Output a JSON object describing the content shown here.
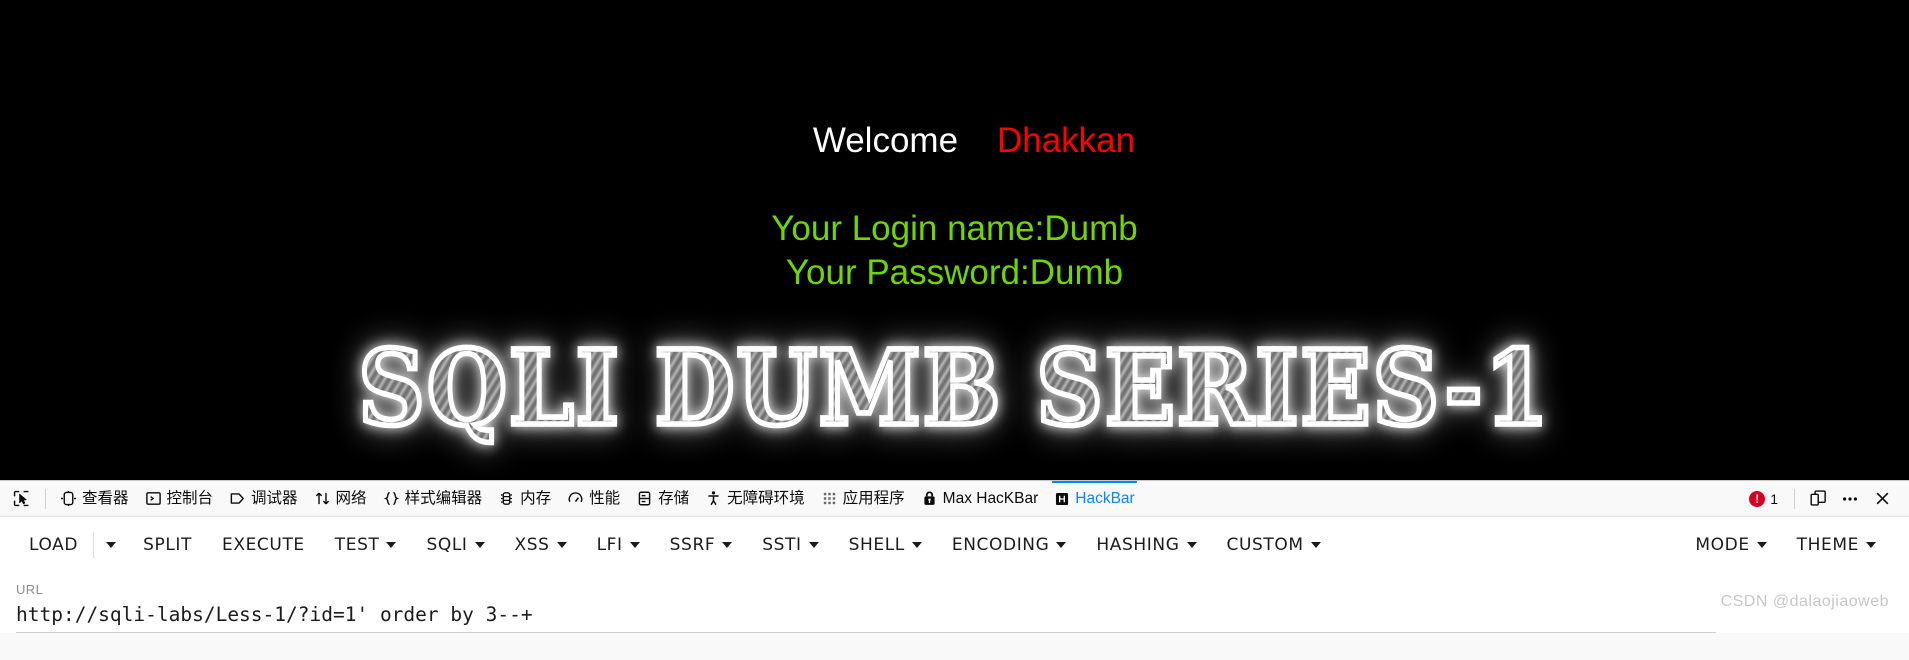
{
  "page": {
    "welcome_prefix": "Welcome",
    "welcome_user": "Dhakkan",
    "login_line": "Your Login name:Dumb",
    "password_line": "Your Password:Dumb",
    "banner_text": "SQLI DUMB SERIES-1",
    "colors": {
      "background": "#000000",
      "welcome_prefix": "#ffffff",
      "welcome_user": "#ff0000",
      "credentials": "#6fd600"
    }
  },
  "devtools": {
    "tabs": [
      {
        "label": "查看器",
        "icon": "inspector-icon",
        "active": false
      },
      {
        "label": "控制台",
        "icon": "console-icon",
        "active": false
      },
      {
        "label": "调试器",
        "icon": "debugger-icon",
        "active": false
      },
      {
        "label": "网络",
        "icon": "network-icon",
        "active": false
      },
      {
        "label": "样式编辑器",
        "icon": "style-editor-icon",
        "active": false
      },
      {
        "label": "内存",
        "icon": "memory-icon",
        "active": false
      },
      {
        "label": "性能",
        "icon": "performance-icon",
        "active": false
      },
      {
        "label": "存储",
        "icon": "storage-icon",
        "active": false
      },
      {
        "label": "无障碍环境",
        "icon": "accessibility-icon",
        "active": false
      },
      {
        "label": "应用程序",
        "icon": "application-icon",
        "active": false
      },
      {
        "label": "Max HacKBar",
        "icon": "lock-icon",
        "active": false
      },
      {
        "label": "HackBar",
        "icon": "hackbar-icon",
        "active": true
      }
    ],
    "picker_icon": "element-picker-icon",
    "right": {
      "error_count": "1",
      "error_icon": "error-badge-icon",
      "responsive_icon": "responsive-design-mode-icon",
      "meatball_icon": "more-options-icon",
      "close_icon": "close-icon"
    },
    "active_tab_color": "#0a84ff",
    "error_color": "#d70022"
  },
  "hackbar": {
    "menu": [
      {
        "label": "LOAD",
        "caret": false,
        "split_caret": true
      },
      {
        "label": "SPLIT",
        "caret": false,
        "split_caret": false
      },
      {
        "label": "EXECUTE",
        "caret": false,
        "split_caret": false
      },
      {
        "label": "TEST",
        "caret": true,
        "split_caret": false
      },
      {
        "label": "SQLI",
        "caret": true,
        "split_caret": false
      },
      {
        "label": "XSS",
        "caret": true,
        "split_caret": false
      },
      {
        "label": "LFI",
        "caret": true,
        "split_caret": false
      },
      {
        "label": "SSRF",
        "caret": true,
        "split_caret": false
      },
      {
        "label": "SSTI",
        "caret": true,
        "split_caret": false
      },
      {
        "label": "SHELL",
        "caret": true,
        "split_caret": false
      },
      {
        "label": "ENCODING",
        "caret": true,
        "split_caret": false
      },
      {
        "label": "HASHING",
        "caret": true,
        "split_caret": false
      },
      {
        "label": "CUSTOM",
        "caret": true,
        "split_caret": false
      }
    ],
    "menu_right": [
      {
        "label": "MODE",
        "caret": true
      },
      {
        "label": "THEME",
        "caret": true
      }
    ],
    "url_label": "URL",
    "url_value": "http://sqli-labs/Less-1/?id=1' order by 3--+",
    "url_placeholder": "URL"
  },
  "watermark": "CSDN @dalaojiaoweb"
}
